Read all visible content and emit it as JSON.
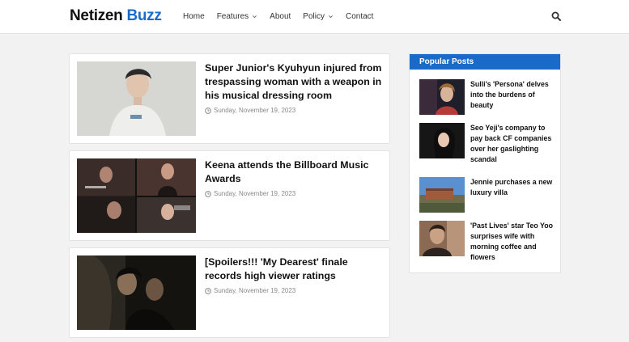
{
  "header": {
    "logo_part1": "Netizen",
    "logo_part2": "Buzz",
    "nav": [
      {
        "label": "Home",
        "dropdown": false
      },
      {
        "label": "Features",
        "dropdown": true
      },
      {
        "label": "About",
        "dropdown": false
      },
      {
        "label": "Policy",
        "dropdown": true
      },
      {
        "label": "Contact",
        "dropdown": false
      }
    ]
  },
  "posts": [
    {
      "title": "Super Junior's Kyuhyun injured from trespassing woman with a weapon in his musical dressing room",
      "date": "Sunday, November 19, 2023"
    },
    {
      "title": "Keena attends the Billboard Music Awards",
      "date": "Sunday, November 19, 2023"
    },
    {
      "title": "[Spoilers!!! 'My Dearest' finale records high viewer ratings",
      "date": "Sunday, November 19, 2023"
    }
  ],
  "sidebar": {
    "heading": "Popular Posts",
    "items": [
      {
        "title": "Sulli's 'Persona' delves into the burdens of beauty"
      },
      {
        "title": "Seo Yeji's company to pay back CF companies over her gaslighting scandal"
      },
      {
        "title": "Jennie purchases a new luxury villa"
      },
      {
        "title": "'Past Lives' star Teo Yoo surprises wife with morning coffee and flowers"
      }
    ]
  },
  "colors": {
    "accent": "#1a6ac9",
    "page_background": "#f2f2f2"
  },
  "icons": [
    "search-icon",
    "clock-icon",
    "chevron-down-icon"
  ]
}
